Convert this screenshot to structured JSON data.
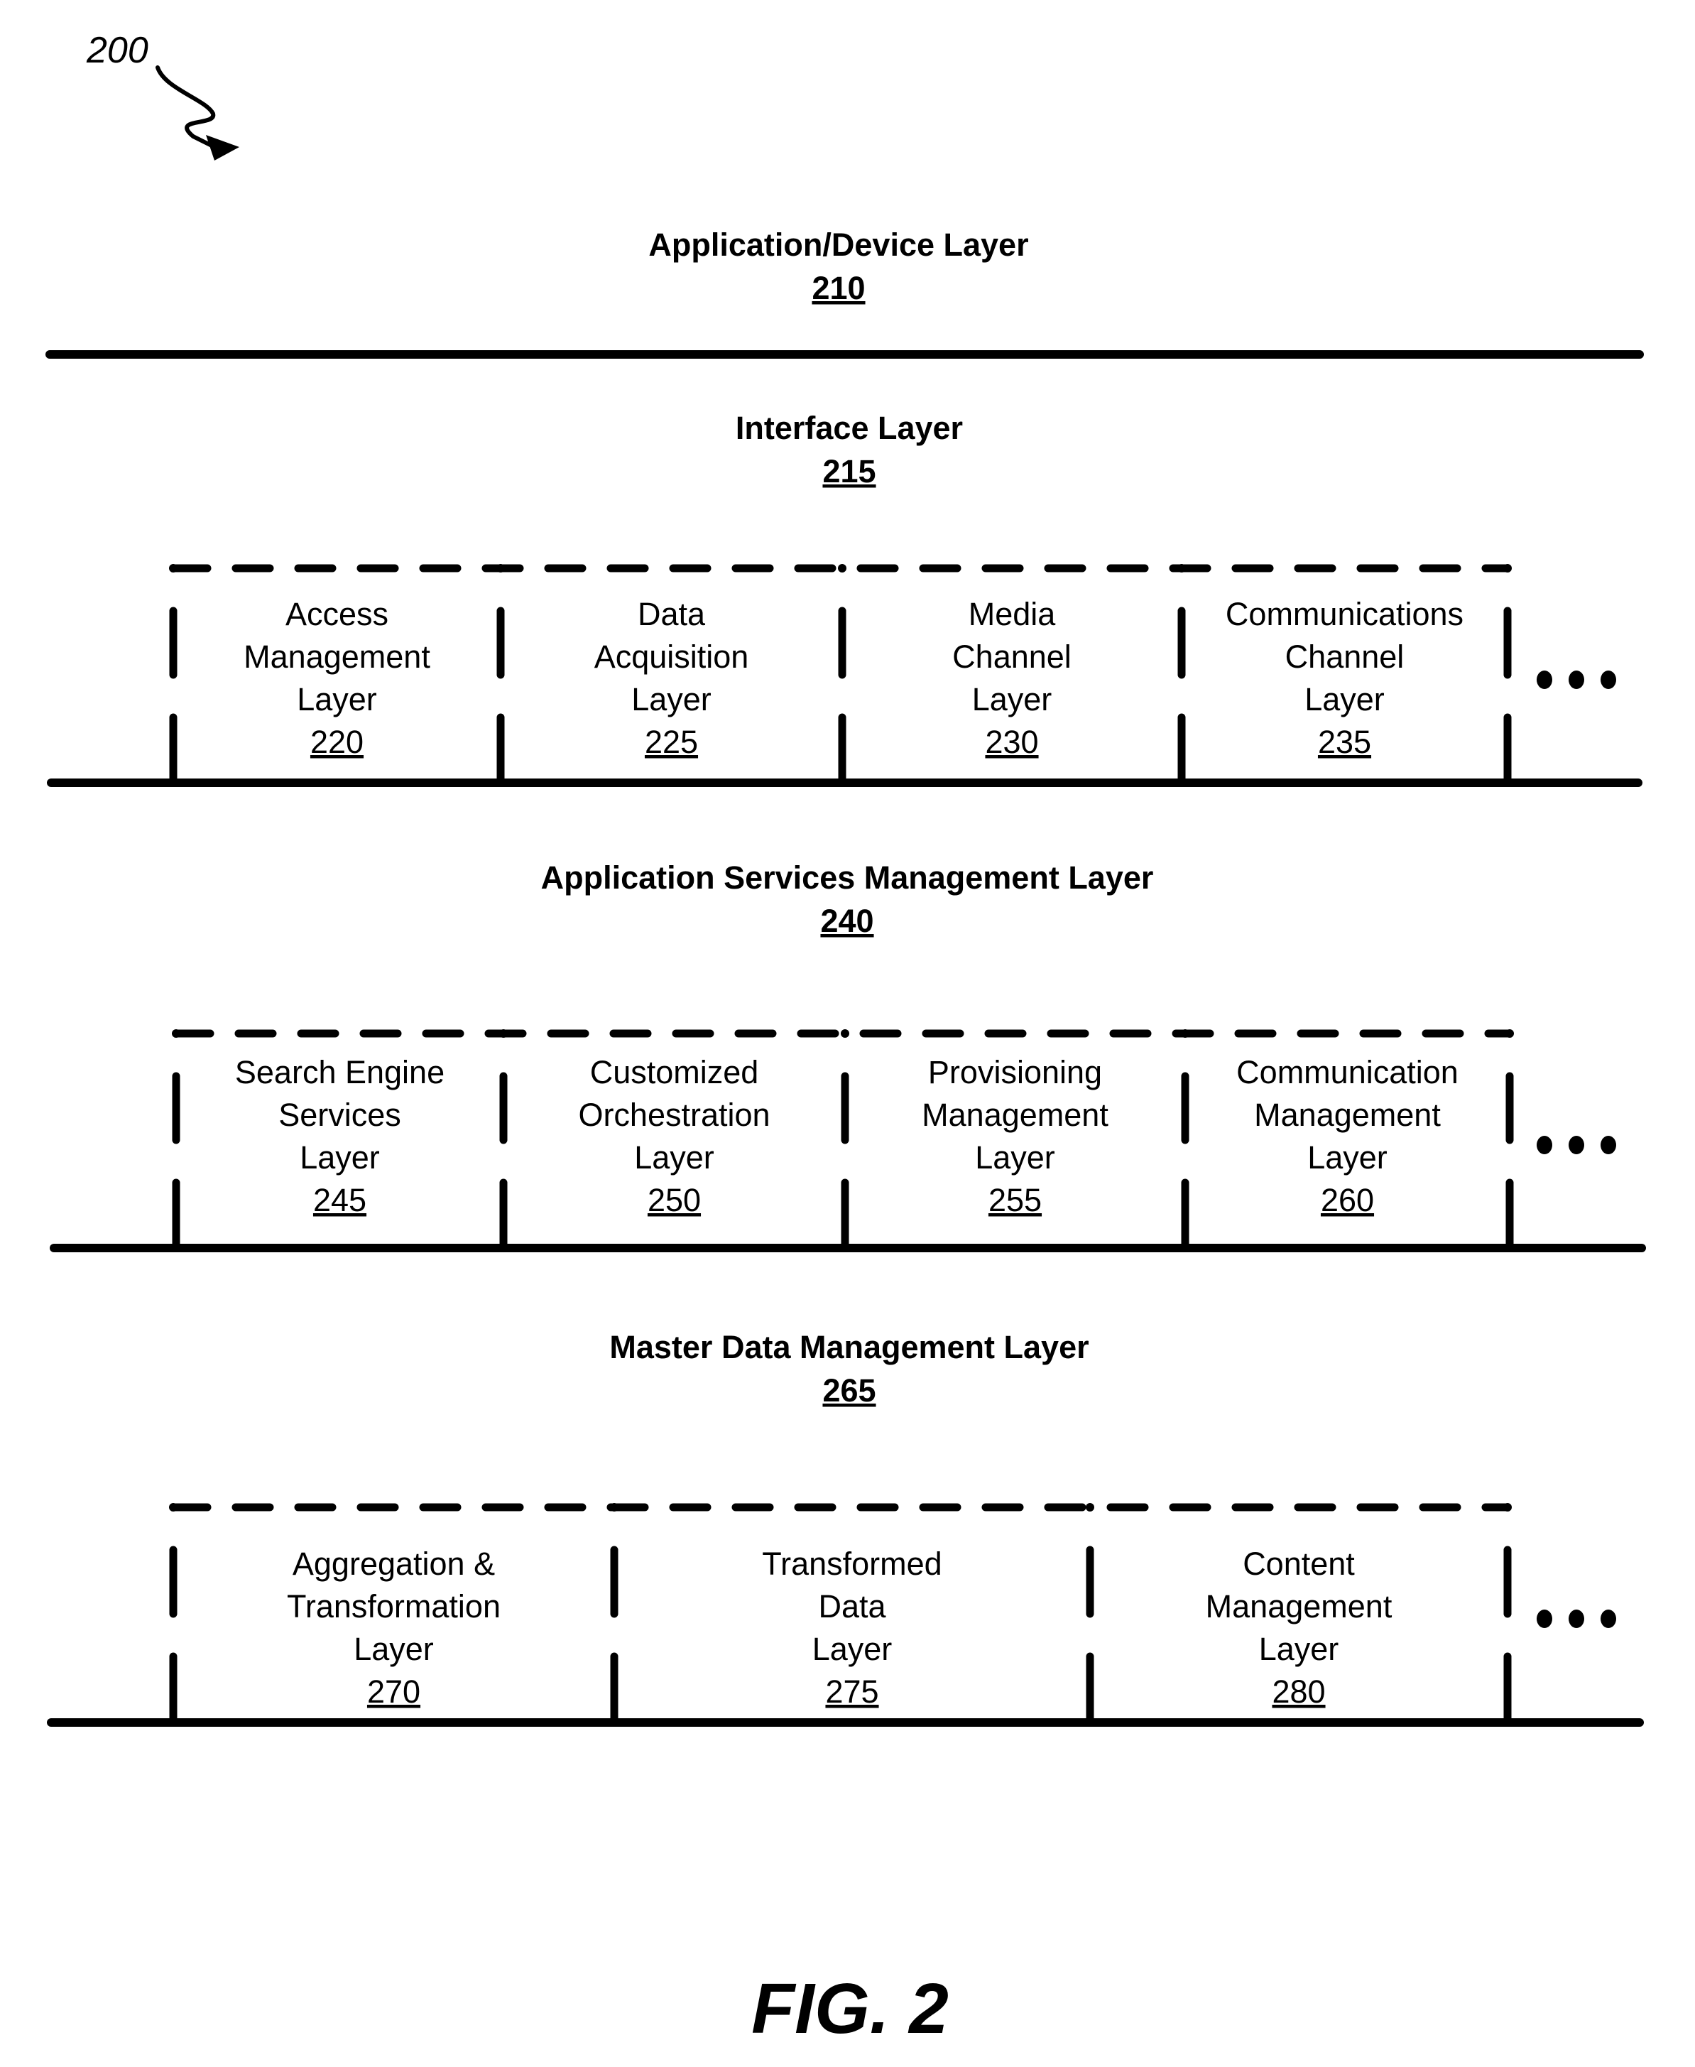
{
  "figure": {
    "reference_numeral": "200",
    "caption": "FIG. 2"
  },
  "layers": [
    {
      "id": "app-device",
      "title": "Application/Device Layer",
      "number": "210",
      "sublayers": [],
      "has_more": false
    },
    {
      "id": "interface",
      "title": "Interface Layer",
      "number": "215",
      "sublayers": [
        {
          "lines": [
            "Access",
            "Management",
            "Layer"
          ],
          "number": "220"
        },
        {
          "lines": [
            "Data",
            "Acquisition",
            "Layer"
          ],
          "number": "225"
        },
        {
          "lines": [
            "Media",
            "Channel",
            "Layer"
          ],
          "number": "230"
        },
        {
          "lines": [
            "Communications",
            "Channel",
            "Layer"
          ],
          "number": "235"
        }
      ],
      "has_more": true
    },
    {
      "id": "app-services",
      "title": "Application Services Management Layer",
      "number": "240",
      "sublayers": [
        {
          "lines": [
            "Search Engine",
            "Services",
            "Layer"
          ],
          "number": "245"
        },
        {
          "lines": [
            "Customized",
            "Orchestration",
            "Layer"
          ],
          "number": "250"
        },
        {
          "lines": [
            "Provisioning",
            "Management",
            "Layer"
          ],
          "number": "255"
        },
        {
          "lines": [
            "Communication",
            "Management",
            "Layer"
          ],
          "number": "260"
        }
      ],
      "has_more": true
    },
    {
      "id": "master-data",
      "title": "Master Data Management Layer",
      "number": "265",
      "sublayers": [
        {
          "lines": [
            "Aggregation &",
            "Transformation",
            "Layer"
          ],
          "number": "270"
        },
        {
          "lines": [
            "Transformed",
            "Data",
            "Layer"
          ],
          "number": "275"
        },
        {
          "lines": [
            "Content",
            "Management",
            "Layer"
          ],
          "number": "280"
        }
      ],
      "has_more": true
    }
  ],
  "ellipsis_icon": "more-dots-icon"
}
